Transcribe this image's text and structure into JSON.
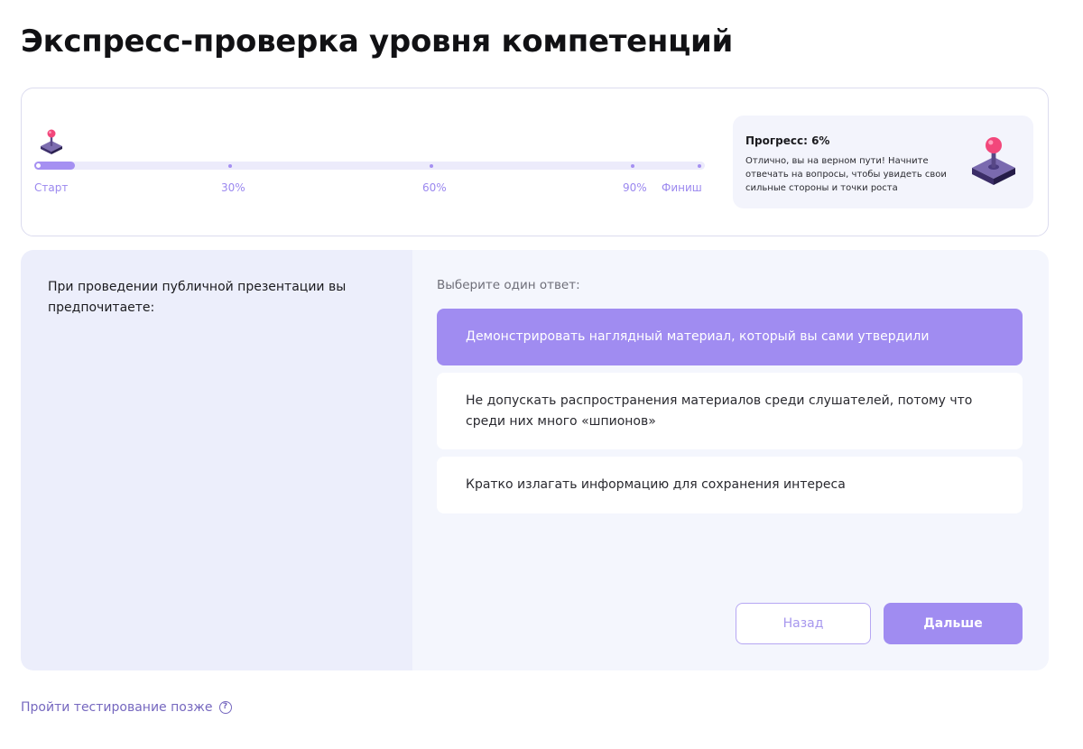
{
  "page": {
    "title": "Экспресс-проверка уровня компетенций"
  },
  "progress": {
    "value": 0.06,
    "markers": [
      {
        "label": "Старт",
        "at": 0
      },
      {
        "label": "30%",
        "at": 0.3
      },
      {
        "label": "60%",
        "at": 0.6
      },
      {
        "label": "90%",
        "at": 0.9
      },
      {
        "label": "Финиш",
        "at": 1.0
      }
    ],
    "info_title": "Прогресс: 6%",
    "info_text": "Отлично, вы на верном пути! Начните отвечать на вопросы, чтобы увидеть свои сильные стороны и точки роста",
    "icon": "joystick-icon"
  },
  "question": {
    "text": "При проведении публичной презентации вы предпочитаете:",
    "hint": "Выберите один ответ:",
    "options": [
      {
        "label": "Демонстрировать наглядный материал, который вы сами утвердили",
        "selected": true
      },
      {
        "label": "Не допускать распространения материалов среди слушателей, потому что среди них много «шпионов»",
        "selected": false
      },
      {
        "label": "Кратко излагать информацию для сохранения интереса",
        "selected": false
      }
    ]
  },
  "nav": {
    "back_label": "Назад",
    "next_label": "Дальше"
  },
  "footer": {
    "later_label": "Пройти тестирование позже",
    "help_icon": "question-circle-icon"
  },
  "colors": {
    "accent": "#a08cf1",
    "accent_light": "#ecebfb",
    "panel_left": "#eceefb",
    "panel_right": "#f4f6fd",
    "link": "#7668bf"
  }
}
